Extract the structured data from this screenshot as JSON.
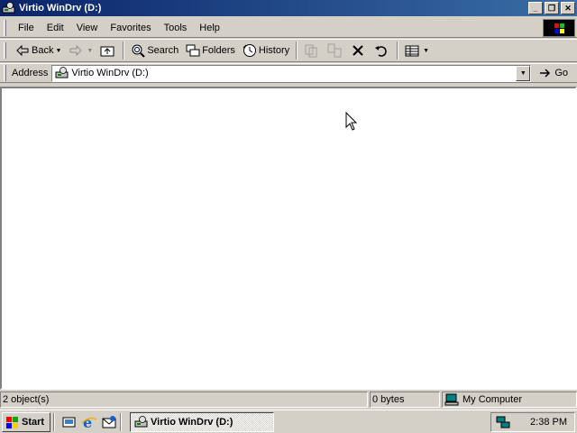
{
  "window": {
    "title": "Virtio WinDrv (D:)",
    "buttons": {
      "minimize": "_",
      "restore": "❐",
      "close": "✕"
    }
  },
  "menu": [
    "File",
    "Edit",
    "View",
    "Favorites",
    "Tools",
    "Help"
  ],
  "toolbar": {
    "back_label": "Back",
    "search_label": "Search",
    "folders_label": "Folders",
    "history_label": "History"
  },
  "address": {
    "label": "Address",
    "value": "Virtio WinDrv (D:)",
    "go_label": "Go"
  },
  "status": {
    "objects": "2 object(s)",
    "size": "0 bytes",
    "zone": "My Computer"
  },
  "taskbar": {
    "start_label": "Start",
    "task_label": "Virtio WinDrv (D:)",
    "clock": "2:38 PM"
  },
  "colors": {
    "title_active_start": "#0a246a",
    "title_active_end": "#3a6ea5",
    "face": "#d4d0c8"
  }
}
